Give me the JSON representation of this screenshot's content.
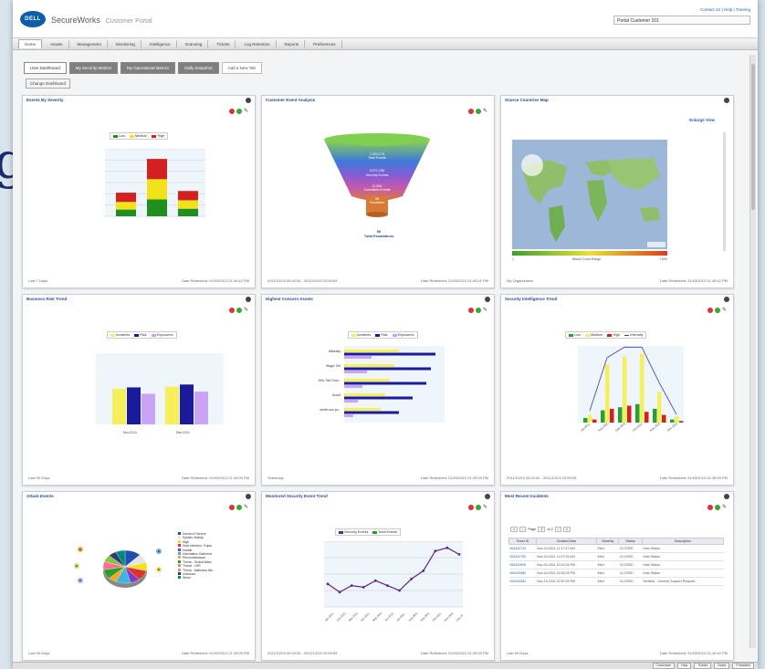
{
  "app": {
    "brand": "SecureWorks",
    "subtitle": "Customer Portal",
    "logo": "DELL",
    "top_links": "Contact Us | Help | Training",
    "customer_select": "Portal Customer 101"
  },
  "nav": [
    "Home",
    "Assets",
    "Management",
    "Monitoring",
    "Intelligence",
    "Scanning",
    "Tickets",
    "Log Retention",
    "Reports",
    "Preferences"
  ],
  "tabs": [
    "User Dashboard",
    "My Security Metrics",
    "My Operational Metrics",
    "Daily Snapshot"
  ],
  "add_tab": "Add a New Tab",
  "change_button": "Change Dashboard",
  "backdrop_letter": "g",
  "panels": {
    "events_by_severity": {
      "title": "Events By Severity",
      "foot_left": "Last 7 Days",
      "foot_right": "Date Refreshed: 01/03/2012 01:40:42 PM",
      "chart_data": {
        "type": "bar",
        "stacked": true,
        "series": [
          {
            "name": "Low",
            "color": "#1f8f1f",
            "values": [
              800,
              2000,
              900
            ]
          },
          {
            "name": "Medium",
            "color": "#f2e21a",
            "values": [
              900,
              2400,
              1000
            ]
          },
          {
            "name": "High",
            "color": "#d42020",
            "values": [
              1100,
              2400,
              1100
            ]
          }
        ],
        "ylim": [
          0,
          12000
        ]
      }
    },
    "customer_event_analysis": {
      "title": "Customer Event Analysis",
      "stages": [
        "1,003,176",
        "Total Events",
        "3,071,196",
        "Security Events",
        "11,808",
        "Correlated Events",
        "58",
        "Escalated"
      ],
      "total": "56",
      "total_label": "Total Escalations",
      "foot_left": "2011/01/03 00:00:00 - 2011/01/03 23:59:59",
      "foot_right": "Date Refreshed: 01/03/2012 01:40:42 PM"
    },
    "source_countries": {
      "title": "Source Countries Map",
      "enlarge": "Enlarge View",
      "scale_left": "1",
      "scale_mid": "Attack Count Range",
      "scale_right": "7,600",
      "org": "My Organization",
      "foot_right": "Date Refreshed: 01/03/2012 01:40:42 PM"
    },
    "business_risk": {
      "title": "Business Risk Trend",
      "legend": [
        "Incidents",
        "Risk",
        "Exposures"
      ],
      "foot_left": "Last 90 Days",
      "foot_right": "Date Refreshed: 01/03/2012 01:35:09 PM",
      "chart_data": {
        "type": "bar",
        "categories": [
          "Nov-2011",
          "Dec-2011"
        ],
        "series": [
          {
            "name": "Incidents",
            "color": "#f5f05a",
            "values": [
              500,
              530
            ]
          },
          {
            "name": "Risk",
            "color": "#1a1a9a",
            "values": [
              520,
              560
            ]
          },
          {
            "name": "Exposures",
            "color": "#c9a3f5",
            "values": [
              430,
              460
            ]
          }
        ],
        "ylim": [
          0,
          1000
        ]
      }
    },
    "highest_concern": {
      "title": "Highest Concern Assets",
      "legend": [
        "Incidents",
        "Risk",
        "Exposures"
      ],
      "assets": [
        "Mikeally",
        "Magic Toll",
        "Jill's Tutt Grou..",
        "Arcull",
        "smith-sun po.."
      ],
      "foot_left": "Yesterday",
      "foot_right": "Date Refreshed: 01/03/2012 01:35:09 PM",
      "chart_data": {
        "type": "bar",
        "orientation": "horizontal",
        "series": [
          {
            "name": "Incidents",
            "color": "#f5f05a",
            "values": [
              0.6,
              0.55,
              0.5,
              0.45,
              0.4
            ]
          },
          {
            "name": "Risk",
            "color": "#1a1a9a",
            "values": [
              1.0,
              0.95,
              0.9,
              0.75,
              0.6
            ]
          },
          {
            "name": "Exposures",
            "color": "#c9a3f5",
            "values": [
              0.3,
              0.25,
              0.2,
              0.15,
              0.1
            ]
          }
        ]
      }
    },
    "security_intel": {
      "title": "Security Intelligence Trend",
      "legend": [
        "Low",
        "Medium",
        "High",
        "Intensity"
      ],
      "foot_left": "2011/01/03 00:00:00 - 2011/12/03 23:59:59",
      "foot_right": "Date Refreshed: 01/03/2012 01:35:09 PM",
      "chart_data": {
        "type": "bar",
        "categories": [
          "Jul-2011",
          "Aug-2011",
          "Sep-2011",
          "Oct-2011",
          "Nov-2011",
          "Dec-2011"
        ],
        "series": [
          {
            "name": "Low",
            "color": "#2aa02a",
            "values": [
              0.3,
              0.8,
              1.0,
              1.2,
              0.9,
              0.2
            ]
          },
          {
            "name": "Medium",
            "color": "#f5f05a",
            "values": [
              0.5,
              3.8,
              4.3,
              4.5,
              2.0,
              0.4
            ]
          },
          {
            "name": "High",
            "color": "#d42020",
            "values": [
              0.2,
              0.9,
              1.1,
              0.7,
              0.5,
              0.1
            ]
          }
        ]
      }
    },
    "attack_events": {
      "title": "Attack Events",
      "legend": [
        "Denial of Service",
        "System Startup",
        "High",
        "Host Infection, Trojan",
        "Hostile",
        "Information Gathered",
        "Reconnaissance",
        "Threat - Global Malw.",
        "Threat - LHR",
        "Threat - Malicious We..",
        "Unknown",
        "Worm"
      ],
      "foot_left": "Last 90 Days",
      "foot_right": "Date Refreshed: 01/03/2012 01:35:09 PM",
      "chart_data": {
        "type": "pie",
        "values": [
          12,
          9,
          8,
          10,
          7,
          11,
          6,
          9,
          8,
          7,
          6,
          7
        ],
        "colors": [
          "#1f4fb3",
          "#e5e5e5",
          "#f2e21a",
          "#e03030",
          "#7d3cc7",
          "#3ab6e0",
          "#f5a623",
          "#2a9d2a",
          "#ff6f91",
          "#8bc34a",
          "#2c3e70",
          "#00897b"
        ]
      }
    },
    "monitored_trend": {
      "title": "Monitored Security Event Trend",
      "legend": [
        "Security Events",
        "Total Events"
      ],
      "foot_left": "2011/01/03 00:00:00 - 2011/12/03 23:59:59",
      "foot_right": "Date Refreshed: 01/03/2012 01:35:09 PM",
      "chart_data": {
        "type": "line",
        "categories": [
          "Jan-2011",
          "Feb-2011",
          "Mar-2011",
          "Apr-2011",
          "May-2011",
          "Jun-2011",
          "Jul-2011",
          "Aug-2011",
          "Sep-2011",
          "Oct-2011",
          "Nov-2011",
          "Dec-2011"
        ],
        "series": [
          {
            "name": "Security Events",
            "color": "#5b2a86",
            "values": [
              70,
              45,
              65,
              60,
              80,
              65,
              50,
              85,
              110,
              170,
              180,
              160
            ]
          }
        ],
        "ylim": [
          0,
          200
        ]
      }
    },
    "recent_incidents": {
      "title": "Most Recent Incidents",
      "page_label": "Page",
      "page": "1",
      "of": "of 2",
      "columns": [
        "Ticket ID",
        "Created Date",
        "Severity",
        "Status",
        "Description"
      ],
      "rows": [
        [
          "IN3432719",
          "Nov-04-2011 11:17:47 AM",
          "Med",
          "CLOSED",
          "Host Status"
        ],
        [
          "IN3432700",
          "Nov-04-2011 11:07:33 AM",
          "Med",
          "CLOSED",
          "Host Status"
        ],
        [
          "IN3433506",
          "Nov-04-2011 10:24:26 PM",
          "Med",
          "CLOSED",
          "Host Status"
        ],
        [
          "IN3433580",
          "Nov-04-2011 02:40:29 PM",
          "Med",
          "CLOSED",
          "Host Status"
        ],
        [
          "IN3434081",
          "Nov-15-2011 02:57:53 PM",
          "Med",
          "CLOSED",
          "Sentinel - General Support Request"
        ]
      ],
      "foot_left": "Last 90 Days",
      "foot_right": "Date Refreshed: 01/03/2012 01:40:42 PM"
    }
  },
  "statusbar": [
    "Customize",
    "Help",
    "Tickets",
    "Notes",
    "Printables"
  ]
}
